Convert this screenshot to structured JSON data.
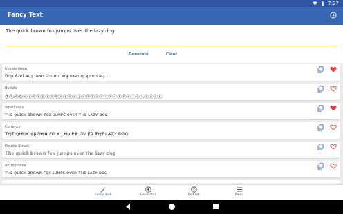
{
  "status_bar": {
    "time": "7:27"
  },
  "app_bar": {
    "title": "Fancy Text",
    "history_icon": "history-icon"
  },
  "input": {
    "value": "The quick brown fox jumps over the lazy dog",
    "accent_color": "#f0c24a"
  },
  "actions": {
    "generate_label": "Generate",
    "clear_label": "Clear"
  },
  "results": [
    {
      "style": "Upside down",
      "text": "ƃop ʎzɐl ǝɥʇ ɹǝʌo sdɯnɾ xoɟ uʍoɹq ʞɔınb ǝɥ⊥",
      "favorite": true
    },
    {
      "style": "Bubble",
      "text": "ⓉⓗⓔⓆⓤⓘⓒⓚⓑⓡⓞⓦⓝⓕⓞⓧⓙⓤⓜⓟⓢⓞⓥⓔⓡⓣⓗⓔⓛⓐⓩⓨⓓⓞⓖ",
      "favorite": false
    },
    {
      "style": "Small caps",
      "text": "ᴛʜᴇ ǫᴜɪᴄᴋ ʙʀᴏᴡɴ ғᴏx ᴊᴜᴍᴘs ᴏᴠᴇʀ ᴛʜᴇ ʟᴀᴢʏ ᴅᴏɢ",
      "favorite": true
    },
    {
      "style": "Currency",
      "text": "₮ⱧɆ QɄł₵₭ ฿ⱤØ₩₦ ₣Ø Ӿ J Ʉ₥₱₴ ØV ɆⱤ ₮ⱧɆ ⱠȺⱫɎ ĐØ₲",
      "favorite": false
    },
    {
      "style": "Double Struck",
      "text": "𝕋𝕙𝕖 𝕢𝕦𝕚𝕔𝕜 𝕓𝕣𝕠𝕨𝕟 𝕗𝕠𝕩 𝕛𝕦𝕞𝕡𝕤 𝕠𝕧𝕖𝕣 𝕥𝕙𝕖 𝕝𝕒𝕫𝕪 𝕕𝕠𝕘",
      "favorite": false
    },
    {
      "style": "Antrophobia",
      "text": "ᴛʜᴇ ǫᴜɪᴄᴋ ʙʀᴏᴡɴ ꜰᴏx ᴊᴜᴍᴘꜱ ᴏᴠᴇʀ ᴛʜᴇ ʟᴀᴢʏ ᴅᴏɢ",
      "favorite": false
    }
  ],
  "colors": {
    "primary": "#3665b3",
    "status_bar": "#2f55a4",
    "heart": "#e23c3c"
  },
  "bottom_nav": [
    {
      "label": "Fancy Text",
      "icon": "magic-wand-icon",
      "active": true
    },
    {
      "label": "Generator",
      "icon": "generator-icon",
      "active": false
    },
    {
      "label": "Text Art",
      "icon": "smiley-icon",
      "active": false
    },
    {
      "label": "Menu",
      "icon": "menu-icon",
      "active": false
    }
  ]
}
